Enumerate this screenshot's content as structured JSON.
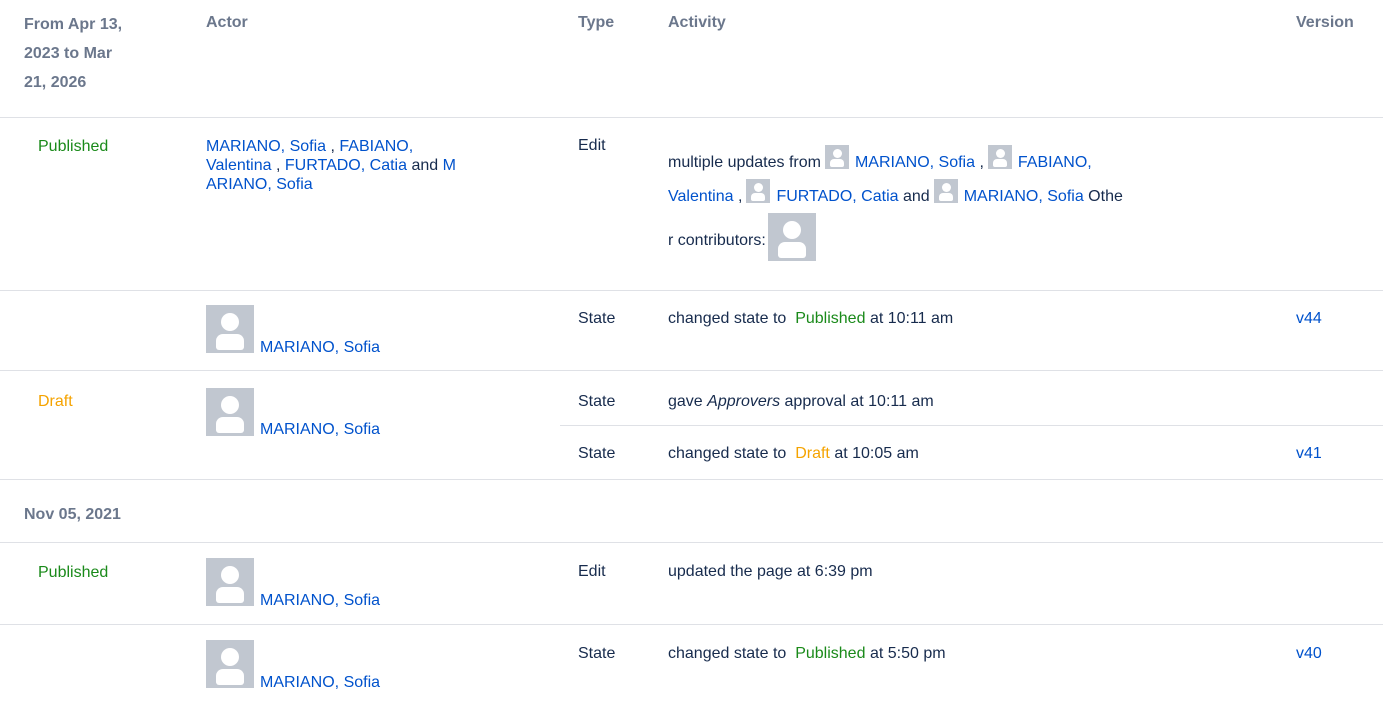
{
  "headers": {
    "date_range_line1": "From Apr 13,",
    "date_range_line2": "2023 to Mar",
    "date_range_line3": "21, 2026",
    "actor": "Actor",
    "type": "Type",
    "activity": "Activity",
    "version": "Version"
  },
  "group1": {
    "row1": {
      "status": "Published",
      "actors": {
        "a1": "MARIANO, Sofia",
        "a2_line1": "FABIANO,",
        "a2_line2": "Valentina",
        "a3": "FURTADO, Catia",
        "and": "and",
        "a4_line1": "M",
        "a4_line2": "ARIANO, Sofia",
        "comma": ","
      },
      "type": "Edit",
      "activity": {
        "prefix": "multiple updates from",
        "u1": "MARIANO, Sofia",
        "u2_line1": "FABIANO,",
        "u2_line2": "Valentina",
        "u3": "FURTADO, Catia",
        "and": "and",
        "u4": "MARIANO, Sofia",
        "others_line1": "Othe",
        "others_line2": "r contributors:",
        "comma": ","
      }
    },
    "row2": {
      "actor": "MARIANO, Sofia",
      "type": "State",
      "act_prefix": "changed state to",
      "act_state": "Published",
      "act_suffix": "at 10:11 am",
      "version": "v44"
    },
    "row3": {
      "status": "Draft",
      "actor": "MARIANO, Sofia",
      "sub1": {
        "type": "State",
        "prefix": "gave",
        "em": "Approvers",
        "suffix": "approval at 10:11 am"
      },
      "sub2": {
        "type": "State",
        "prefix": "changed state to",
        "state": "Draft",
        "suffix": "at 10:05 am",
        "version": "v41"
      }
    }
  },
  "group2": {
    "date": "Nov 05, 2021",
    "row1": {
      "status": "Published",
      "actor": "MARIANO, Sofia",
      "type": "Edit",
      "activity": "updated the page at 6:39 pm"
    },
    "row2": {
      "actor": "MARIANO, Sofia",
      "type": "State",
      "act_prefix": "changed state to",
      "act_state": "Published",
      "act_suffix": "at 5:50 pm",
      "version": "v40"
    }
  },
  "colors": {
    "link": "#0052cc",
    "published": "#1a8a1a",
    "draft": "#f5a300",
    "header": "#6b778c",
    "avatar_bg": "#c1c7d0"
  }
}
